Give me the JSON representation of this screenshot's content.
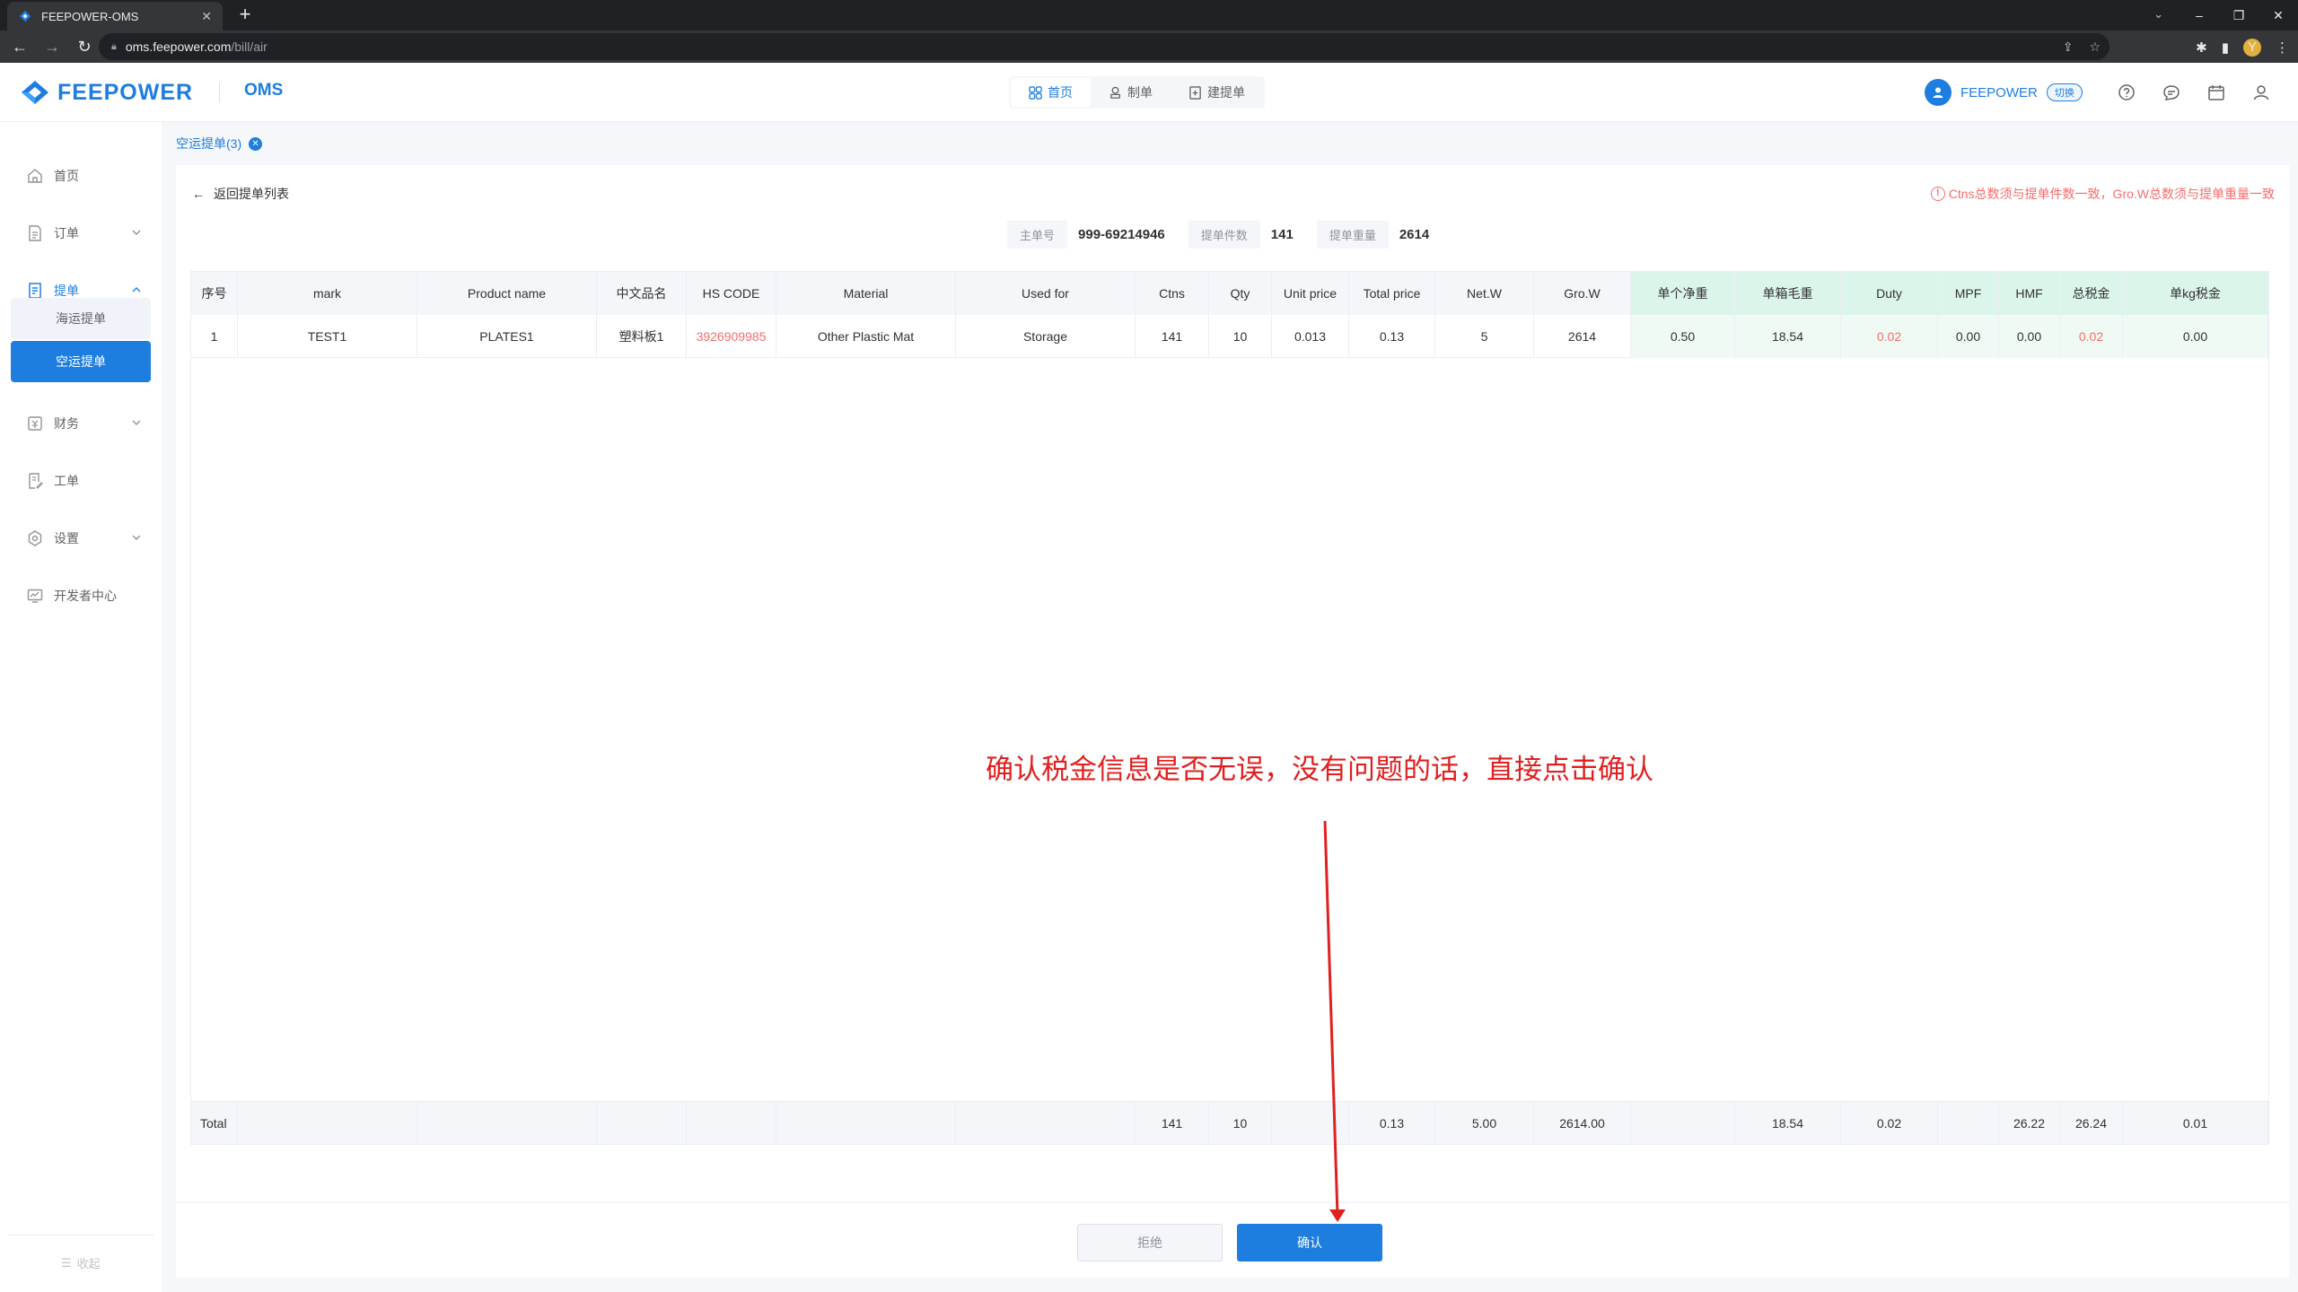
{
  "browser": {
    "tab_title": "FEEPOWER-OMS",
    "url_host": "oms.feepower.com",
    "url_path": "/bill/air"
  },
  "header": {
    "brand": "FEEPOWER",
    "product": "OMS",
    "nav": [
      {
        "label": "首页",
        "icon": "grid-icon",
        "active": true
      },
      {
        "label": "制单",
        "icon": "stamp-icon",
        "active": false
      },
      {
        "label": "建提单",
        "icon": "add-doc-icon",
        "active": false
      }
    ],
    "user_name": "FEEPOWER",
    "switch_label": "切换",
    "accent": "#1e7ee0"
  },
  "sidebar": {
    "items": [
      {
        "label": "首页",
        "icon": "home-icon"
      },
      {
        "label": "订单",
        "icon": "order-icon"
      },
      {
        "label": "提单",
        "icon": "bill-icon"
      },
      {
        "label": "财务",
        "icon": "finance-icon"
      },
      {
        "label": "工单",
        "icon": "ticket-icon"
      },
      {
        "label": "设置",
        "icon": "settings-icon"
      },
      {
        "label": "开发者中心",
        "icon": "developer-icon"
      }
    ],
    "sub_items": [
      {
        "label": "海运提单"
      },
      {
        "label": "空运提单"
      }
    ],
    "collapse_label": "收起"
  },
  "page": {
    "tab_label": "空运提单(3)",
    "back_label": "返回提单列表",
    "warning": "Ctns总数须与提单件数一致，Gro.W总数须与提单重量一致",
    "summary": [
      {
        "label": "主单号",
        "value": "999-69214946"
      },
      {
        "label": "提单件数",
        "value": "141"
      },
      {
        "label": "提单重量",
        "value": "2614"
      }
    ]
  },
  "table": {
    "headers": [
      "序号",
      "mark",
      "Product name",
      "中文品名",
      "HS CODE",
      "Material",
      "Used for",
      "Ctns",
      "Qty",
      "Unit price",
      "Total price",
      "Net.W",
      "Gro.W",
      "单个净重",
      "单箱毛重",
      "Duty",
      "MPF",
      "HMF",
      "总税金",
      "单kg税金"
    ],
    "rows": [
      [
        "1",
        "TEST1",
        "PLATES1",
        "塑料板1",
        "3926909985",
        "Other Plastic Mat",
        "Storage",
        "141",
        "10",
        "0.013",
        "0.13",
        "5",
        "2614",
        "0.50",
        "18.54",
        "0.02",
        "0.00",
        "0.00",
        "0.02",
        "0.00"
      ]
    ],
    "total": [
      "Total",
      "",
      "",
      "",
      "",
      "",
      "",
      "141",
      "10",
      "",
      "0.13",
      "5.00",
      "2614.00",
      "",
      "18.54",
      "0.02",
      "",
      "26.22",
      "26.24",
      "0.01"
    ]
  },
  "buttons": {
    "reject": "拒绝",
    "confirm": "确认"
  },
  "annotation": {
    "text": "确认税金信息是否无误，没有问题的话，直接点击确认",
    "color": "#e02020"
  }
}
